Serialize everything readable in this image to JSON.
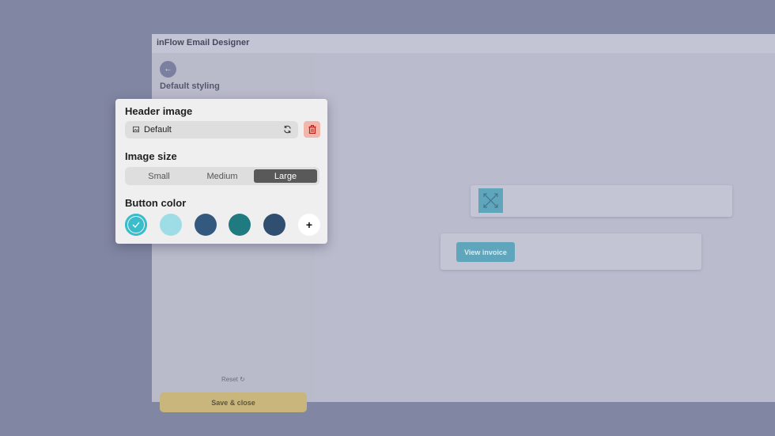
{
  "window": {
    "title": "inFlow Email Designer"
  },
  "sidebar": {
    "back_icon": "arrow-left-icon",
    "title": "Default styling",
    "reset_label": "Reset",
    "reset_icon": "refresh-icon",
    "save_label": "Save & close"
  },
  "popup": {
    "header_image_title": "Header image",
    "header_image_value": "Default",
    "image_size_title": "Image size",
    "image_size_options": [
      "Small",
      "Medium",
      "Large"
    ],
    "image_size_selected": "Large",
    "button_color_title": "Button color",
    "colors": {
      "swatch_1": "#3bbccb",
      "swatch_2": "#9edde6",
      "swatch_3": "#33597e",
      "swatch_4": "#1f7b80",
      "swatch_5": "#2f4e70"
    },
    "selected_color": "#3bbccb",
    "add_color_symbol": "+"
  },
  "canvas": {
    "header_image_placeholder_icon": "image-placeholder-icon",
    "view_invoice_label": "View invoice",
    "accent_color": "#5fa5bc"
  }
}
